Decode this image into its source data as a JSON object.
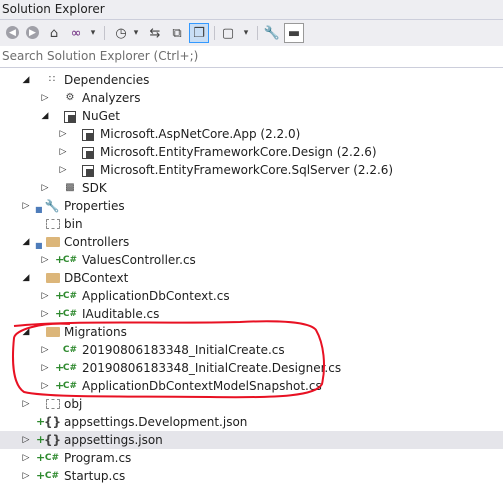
{
  "window": {
    "title": "Solution Explorer"
  },
  "toolbar": {
    "back_icon": "back-arrow-icon",
    "forward_icon": "forward-arrow-icon",
    "home_icon": "home-icon",
    "icons": [
      "back-arrow-icon",
      "forward-arrow-icon",
      "home-icon",
      "visual-studio-icon",
      "history-icon",
      "sync-icon",
      "collapse-all-icon",
      "copy-icon",
      "show-all-files-icon",
      "properties-icon",
      "wrench-icon",
      "preview-icon"
    ]
  },
  "search": {
    "placeholder": "Search Solution Explorer (Ctrl+;)"
  },
  "tree": {
    "dependencies": "Dependencies",
    "analyzers": "Analyzers",
    "nuget": "NuGet",
    "pkg1": "Microsoft.AspNetCore.App (2.2.0)",
    "pkg2": "Microsoft.EntityFrameworkCore.Design (2.2.6)",
    "pkg3": "Microsoft.EntityFrameworkCore.SqlServer (2.2.6)",
    "sdk": "SDK",
    "properties": "Properties",
    "bin": "bin",
    "controllers": "Controllers",
    "values_controller": "ValuesController.cs",
    "dbcontext": "DBContext",
    "app_db_context": "ApplicationDbContext.cs",
    "iauditable": "IAuditable.cs",
    "migrations": "Migrations",
    "mig1": "20190806183348_InitialCreate.cs",
    "mig2": "20190806183348_InitialCreate.Designer.cs",
    "mig3": "ApplicationDbContextModelSnapshot.cs",
    "obj": "obj",
    "appsettings_dev": "appsettings.Development.json",
    "appsettings": "appsettings.json",
    "program": "Program.cs",
    "startup": "Startup.cs",
    "cs_badge": "C#"
  },
  "colors": {
    "annotation": "#e81123",
    "selection": "#cce4f7",
    "folder": "#dcb67a",
    "csharp": "#2f8a2f"
  }
}
